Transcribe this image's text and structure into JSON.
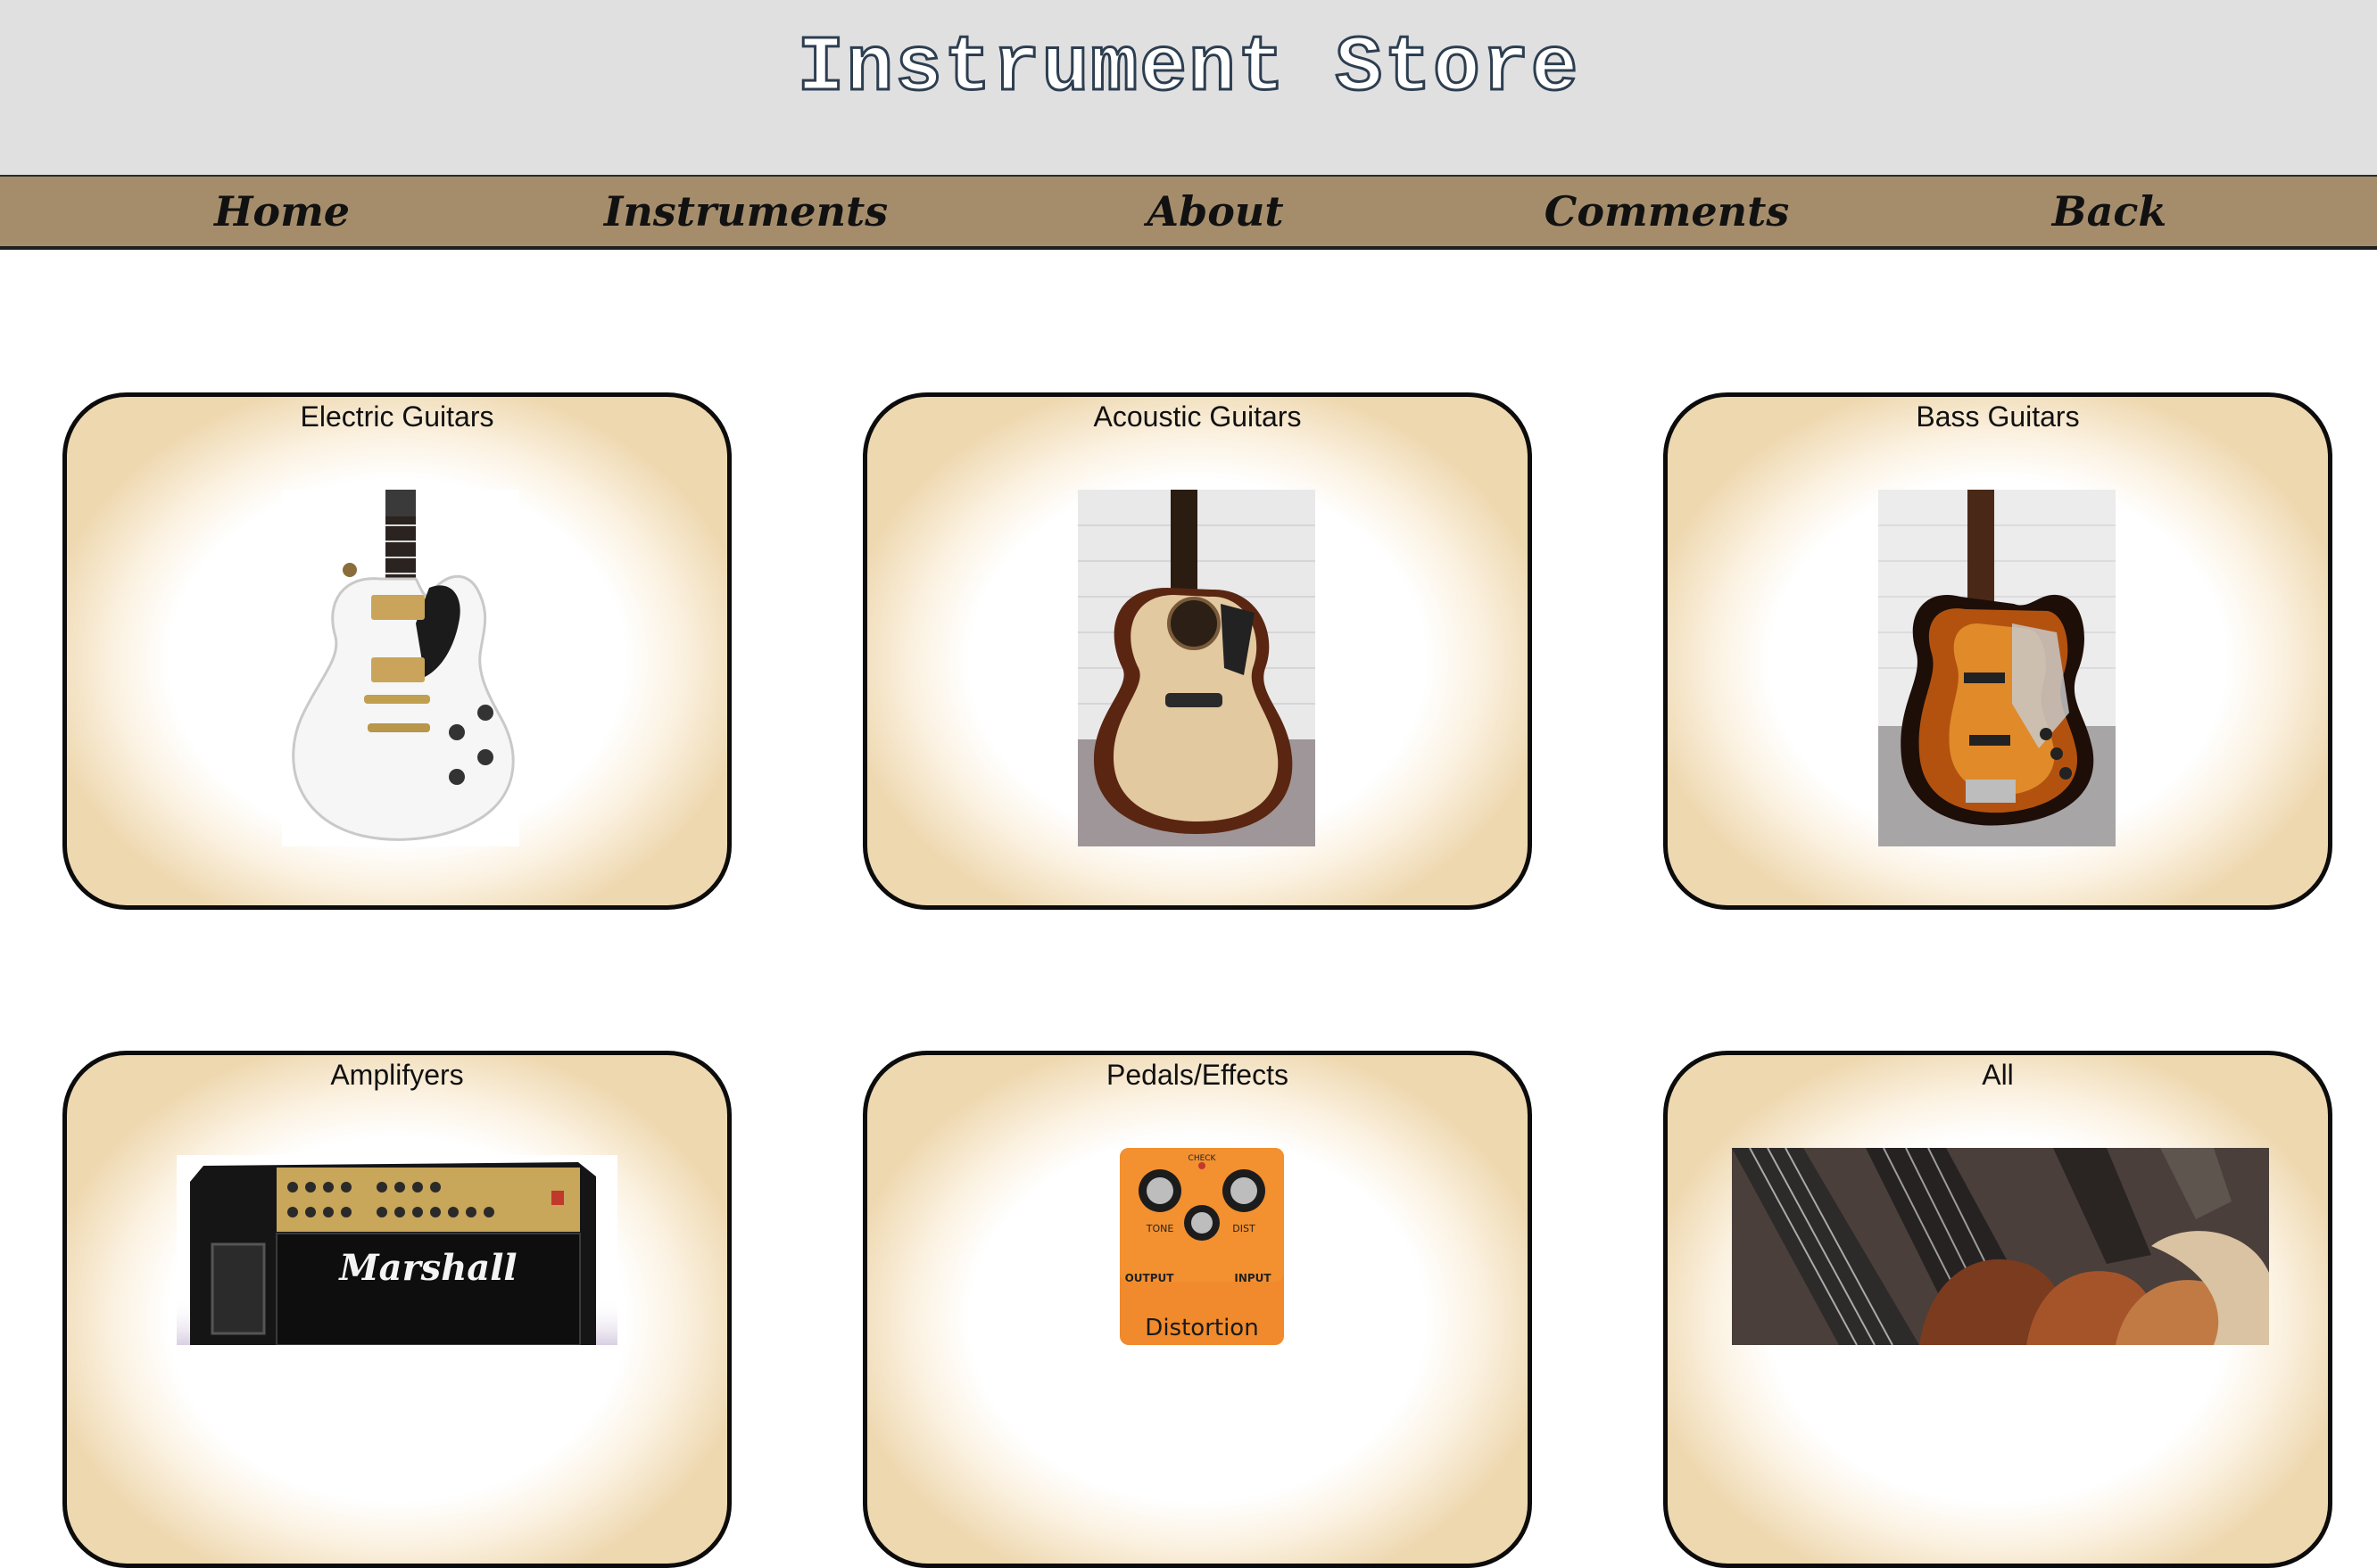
{
  "header": {
    "title": "Instrument Store"
  },
  "nav": {
    "items": [
      {
        "label": "Home"
      },
      {
        "label": "Instruments"
      },
      {
        "label": "About"
      },
      {
        "label": "Comments"
      },
      {
        "label": "Back"
      }
    ]
  },
  "categories": [
    {
      "title": "Electric Guitars",
      "image": "electric-guitar-image"
    },
    {
      "title": "Acoustic Guitars",
      "image": "acoustic-guitar-image"
    },
    {
      "title": "Bass Guitars",
      "image": "bass-guitar-image"
    },
    {
      "title": "Amplifyers",
      "image": "amplifier-image"
    },
    {
      "title": "Pedals/Effects",
      "image": "pedal-image",
      "pedal_labels": {
        "check": "CHECK",
        "tone": "TONE",
        "dist": "DIST",
        "output": "OUTPUT",
        "input": "INPUT",
        "name": "Distortion"
      }
    },
    {
      "title": "All",
      "image": "guitars-collage-image"
    }
  ],
  "amp_brand": "Marshall",
  "colors": {
    "header_bg": "#e0e0e1",
    "nav_bg": "#a58d6c",
    "title_outline": "#2d3e50",
    "card_edge": "#eed8b0"
  }
}
